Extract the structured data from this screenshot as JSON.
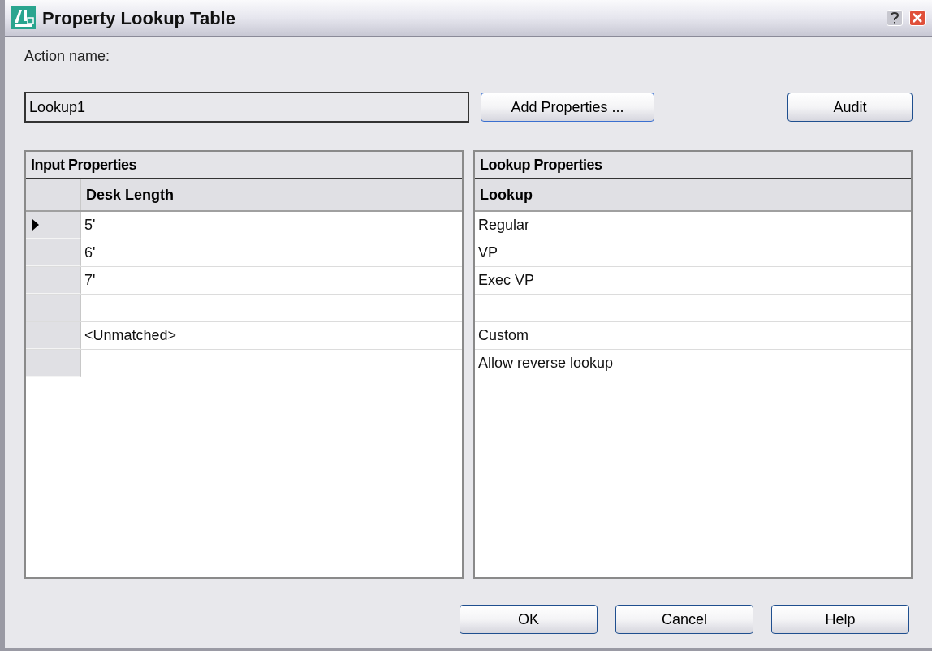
{
  "window": {
    "title": "Property Lookup Table"
  },
  "action_name": {
    "label": "Action name:",
    "value": "Lookup1"
  },
  "top_buttons": [
    "Add Properties ...",
    "Audit"
  ],
  "input_properties": {
    "title": "Input Properties",
    "column": "Desk Length",
    "rows": [
      {
        "value": "5'",
        "selected": true
      },
      {
        "value": "6'",
        "selected": false
      },
      {
        "value": "7'",
        "selected": false
      },
      {
        "selected": false
      },
      {
        "value": "<Unmatched>",
        "selected": false
      },
      {
        "selected": false
      }
    ]
  },
  "lookup_properties": {
    "title": "Lookup Properties",
    "column": "Lookup",
    "rows": [
      {
        "value": "Regular"
      },
      {
        "value": "VP"
      },
      {
        "value": "Exec VP"
      },
      {},
      {
        "value": "Custom"
      },
      {
        "value": "Allow reverse lookup"
      }
    ]
  },
  "bottom_buttons": [
    "OK",
    "Cancel",
    "Help"
  ]
}
